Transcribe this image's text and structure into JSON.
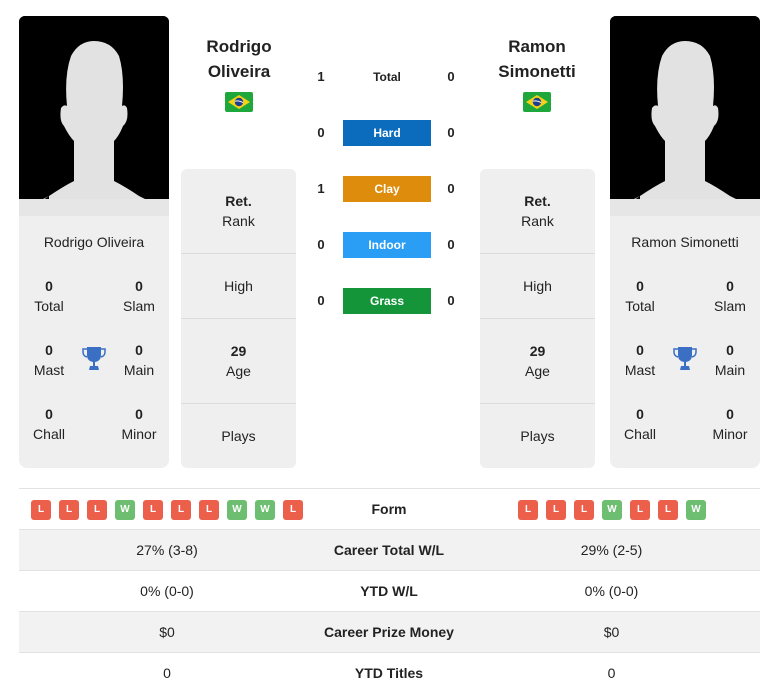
{
  "players": [
    {
      "name_line1": "Rodrigo",
      "name_line2": "Oliveira",
      "full_name": "Rodrigo Oliveira",
      "flag": "brazil-flag",
      "titles": {
        "total": "0",
        "slam": "0",
        "mast": "0",
        "main": "0",
        "chall": "0",
        "minor": "0"
      },
      "info": {
        "rank_value": "Ret.",
        "rank_label": "Rank",
        "high_label": "High",
        "age_value": "29",
        "age_label": "Age",
        "plays_label": "Plays"
      },
      "form": [
        "L",
        "L",
        "L",
        "W",
        "L",
        "L",
        "L",
        "W",
        "W",
        "L"
      ],
      "career_total_wl": "27% (3-8)",
      "ytd_wl": "0% (0-0)",
      "career_prize_money": "$0",
      "ytd_titles": "0"
    },
    {
      "name_line1": "Ramon",
      "name_line2": "Simonetti",
      "full_name": "Ramon Simonetti",
      "flag": "brazil-flag",
      "titles": {
        "total": "0",
        "slam": "0",
        "mast": "0",
        "main": "0",
        "chall": "0",
        "minor": "0"
      },
      "info": {
        "rank_value": "Ret.",
        "rank_label": "Rank",
        "high_label": "High",
        "age_value": "29",
        "age_label": "Age",
        "plays_label": "Plays"
      },
      "form": [
        "L",
        "L",
        "L",
        "W",
        "L",
        "L",
        "W"
      ],
      "career_total_wl": "29% (2-5)",
      "ytd_wl": "0% (0-0)",
      "career_prize_money": "$0",
      "ytd_titles": "0"
    }
  ],
  "title_labels": {
    "total": "Total",
    "slam": "Slam",
    "mast": "Mast",
    "main": "Main",
    "chall": "Chall",
    "minor": "Minor"
  },
  "h2h": [
    {
      "label": "Total",
      "left": "1",
      "right": "0",
      "color": ""
    },
    {
      "label": "Hard",
      "left": "0",
      "right": "0",
      "color": "#0b6cbd"
    },
    {
      "label": "Clay",
      "left": "1",
      "right": "0",
      "color": "#dd8c0b"
    },
    {
      "label": "Indoor",
      "left": "0",
      "right": "0",
      "color": "#2a9df4"
    },
    {
      "label": "Grass",
      "left": "0",
      "right": "0",
      "color": "#14953a"
    }
  ],
  "stat_labels": {
    "form": "Form",
    "career_total_wl": "Career Total W/L",
    "ytd_wl": "YTD W/L",
    "career_prize_money": "Career Prize Money",
    "ytd_titles": "YTD Titles"
  },
  "colors": {
    "loss": "#ec5f4b",
    "win": "#6ebe71",
    "trophy": "#3a6fc4"
  }
}
